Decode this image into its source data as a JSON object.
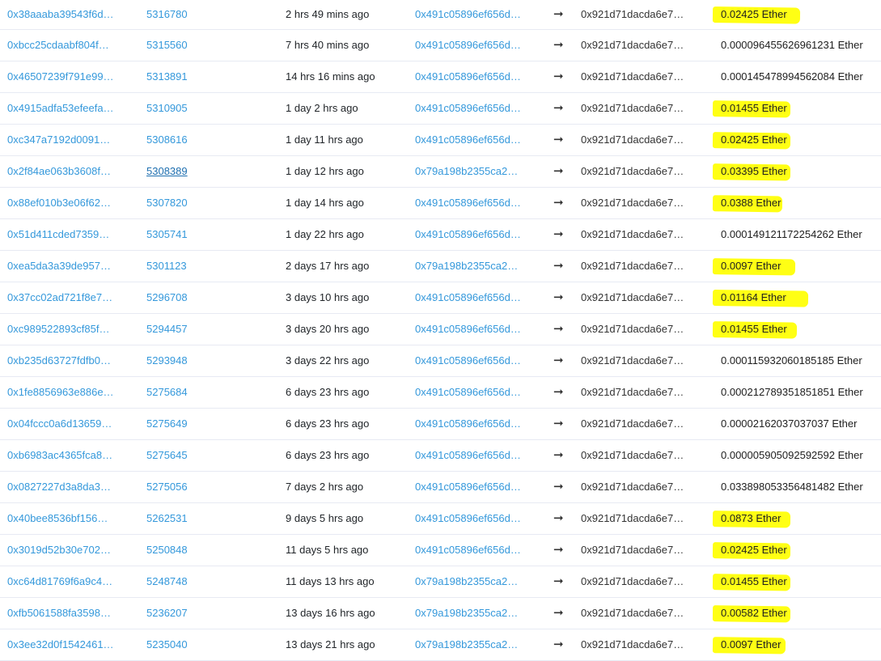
{
  "colors": {
    "link": "#3498db",
    "highlight": "#ffff14",
    "row_border": "#e7eaf3"
  },
  "arrow_icon": "right-arrow-icon",
  "rows": [
    {
      "hash": "0x38aaaba39543f6d…",
      "block": "5316780",
      "age": "2 hrs 49 mins ago",
      "from": "0x491c05896ef656d…",
      "arrow": "➞",
      "to": "0x921d71dacda6e7…",
      "value": "0.02425 Ether",
      "highlighted": true,
      "hl_width": 108
    },
    {
      "hash": "0xbcc25cdaabf804f…",
      "block": "5315560",
      "age": "7 hrs 40 mins ago",
      "from": "0x491c05896ef656d…",
      "arrow": "➞",
      "to": "0x921d71dacda6e7…",
      "value": "0.000096455626961231 Ether",
      "highlighted": false
    },
    {
      "hash": "0x46507239f791e99…",
      "block": "5313891",
      "age": "14 hrs 16 mins ago",
      "from": "0x491c05896ef656d…",
      "arrow": "➞",
      "to": "0x921d71dacda6e7…",
      "value": "0.000145478994562084 Ether",
      "highlighted": false
    },
    {
      "hash": "0x4915adfa53efeefa…",
      "block": "5310905",
      "age": "1 day 2 hrs ago",
      "from": "0x491c05896ef656d…",
      "arrow": "➞",
      "to": "0x921d71dacda6e7…",
      "value": "0.01455 Ether",
      "highlighted": true,
      "hl_width": 96
    },
    {
      "hash": "0xc347a7192d0091…",
      "block": "5308616",
      "age": "1 day 11 hrs ago",
      "from": "0x491c05896ef656d…",
      "arrow": "➞",
      "to": "0x921d71dacda6e7…",
      "value": "0.02425 Ether",
      "highlighted": true,
      "hl_width": 96
    },
    {
      "hash": "0x2f84ae063b3608f…",
      "block": "5308389",
      "age": "1 day 12 hrs ago",
      "from": "0x79a198b2355ca2…",
      "arrow": "➞",
      "to": "0x921d71dacda6e7…",
      "value": "0.03395 Ether",
      "highlighted": true,
      "hl_width": 96,
      "block_underlined": true
    },
    {
      "hash": "0x88ef010b3e06f62…",
      "block": "5307820",
      "age": "1 day 14 hrs ago",
      "from": "0x491c05896ef656d…",
      "arrow": "➞",
      "to": "0x921d71dacda6e7…",
      "value": "0.0388 Ether",
      "highlighted": true,
      "hl_width": 86
    },
    {
      "hash": "0x51d411cded7359…",
      "block": "5305741",
      "age": "1 day 22 hrs ago",
      "from": "0x491c05896ef656d…",
      "arrow": "➞",
      "to": "0x921d71dacda6e7…",
      "value": "0.000149121172254262 Ether",
      "highlighted": false
    },
    {
      "hash": "0xea5da3a39de957…",
      "block": "5301123",
      "age": "2 days 17 hrs ago",
      "from": "0x79a198b2355ca2…",
      "arrow": "➞",
      "to": "0x921d71dacda6e7…",
      "value": "0.0097 Ether",
      "highlighted": true,
      "hl_width": 102
    },
    {
      "hash": "0x37cc02ad721f8e7…",
      "block": "5296708",
      "age": "3 days 10 hrs ago",
      "from": "0x491c05896ef656d…",
      "arrow": "➞",
      "to": "0x921d71dacda6e7…",
      "value": "0.01164 Ether",
      "highlighted": true,
      "hl_width": 118
    },
    {
      "hash": "0xc989522893cf85f…",
      "block": "5294457",
      "age": "3 days 20 hrs ago",
      "from": "0x491c05896ef656d…",
      "arrow": "➞",
      "to": "0x921d71dacda6e7…",
      "value": "0.01455 Ether",
      "highlighted": true,
      "hl_width": 104
    },
    {
      "hash": "0xb235d63727fdfb0…",
      "block": "5293948",
      "age": "3 days 22 hrs ago",
      "from": "0x491c05896ef656d…",
      "arrow": "➞",
      "to": "0x921d71dacda6e7…",
      "value": "0.000115932060185185 Ether",
      "highlighted": false
    },
    {
      "hash": "0x1fe8856963e886e…",
      "block": "5275684",
      "age": "6 days 23 hrs ago",
      "from": "0x491c05896ef656d…",
      "arrow": "➞",
      "to": "0x921d71dacda6e7…",
      "value": "0.000212789351851851 Ether",
      "highlighted": false
    },
    {
      "hash": "0x04fccc0a6d13659…",
      "block": "5275649",
      "age": "6 days 23 hrs ago",
      "from": "0x491c05896ef656d…",
      "arrow": "➞",
      "to": "0x921d71dacda6e7…",
      "value": "0.00002162037037037 Ether",
      "highlighted": false
    },
    {
      "hash": "0xb6983ac4365fca8…",
      "block": "5275645",
      "age": "6 days 23 hrs ago",
      "from": "0x491c05896ef656d…",
      "arrow": "➞",
      "to": "0x921d71dacda6e7…",
      "value": "0.000005905092592592 Ether",
      "highlighted": false
    },
    {
      "hash": "0x0827227d3a8da3…",
      "block": "5275056",
      "age": "7 days 2 hrs ago",
      "from": "0x491c05896ef656d…",
      "arrow": "➞",
      "to": "0x921d71dacda6e7…",
      "value": "0.033898053356481482 Ether",
      "highlighted": false
    },
    {
      "hash": "0x40bee8536bf156…",
      "block": "5262531",
      "age": "9 days 5 hrs ago",
      "from": "0x491c05896ef656d…",
      "arrow": "➞",
      "to": "0x921d71dacda6e7…",
      "value": "0.0873 Ether",
      "highlighted": true,
      "hl_width": 96
    },
    {
      "hash": "0x3019d52b30e702…",
      "block": "5250848",
      "age": "11 days 5 hrs ago",
      "from": "0x491c05896ef656d…",
      "arrow": "➞",
      "to": "0x921d71dacda6e7…",
      "value": "0.02425 Ether",
      "highlighted": true,
      "hl_width": 96
    },
    {
      "hash": "0xc64d81769f6a9c4…",
      "block": "5248748",
      "age": "11 days 13 hrs ago",
      "from": "0x79a198b2355ca2…",
      "arrow": "➞",
      "to": "0x921d71dacda6e7…",
      "value": "0.01455 Ether",
      "highlighted": true,
      "hl_width": 96
    },
    {
      "hash": "0xfb5061588fa3598…",
      "block": "5236207",
      "age": "13 days 16 hrs ago",
      "from": "0x79a198b2355ca2…",
      "arrow": "➞",
      "to": "0x921d71dacda6e7…",
      "value": "0.00582 Ether",
      "highlighted": true,
      "hl_width": 96
    },
    {
      "hash": "0x3ee32d0f1542461…",
      "block": "5235040",
      "age": "13 days 21 hrs ago",
      "from": "0x79a198b2355ca2…",
      "arrow": "➞",
      "to": "0x921d71dacda6e7…",
      "value": "0.0097 Ether",
      "highlighted": true,
      "hl_width": 90
    }
  ]
}
